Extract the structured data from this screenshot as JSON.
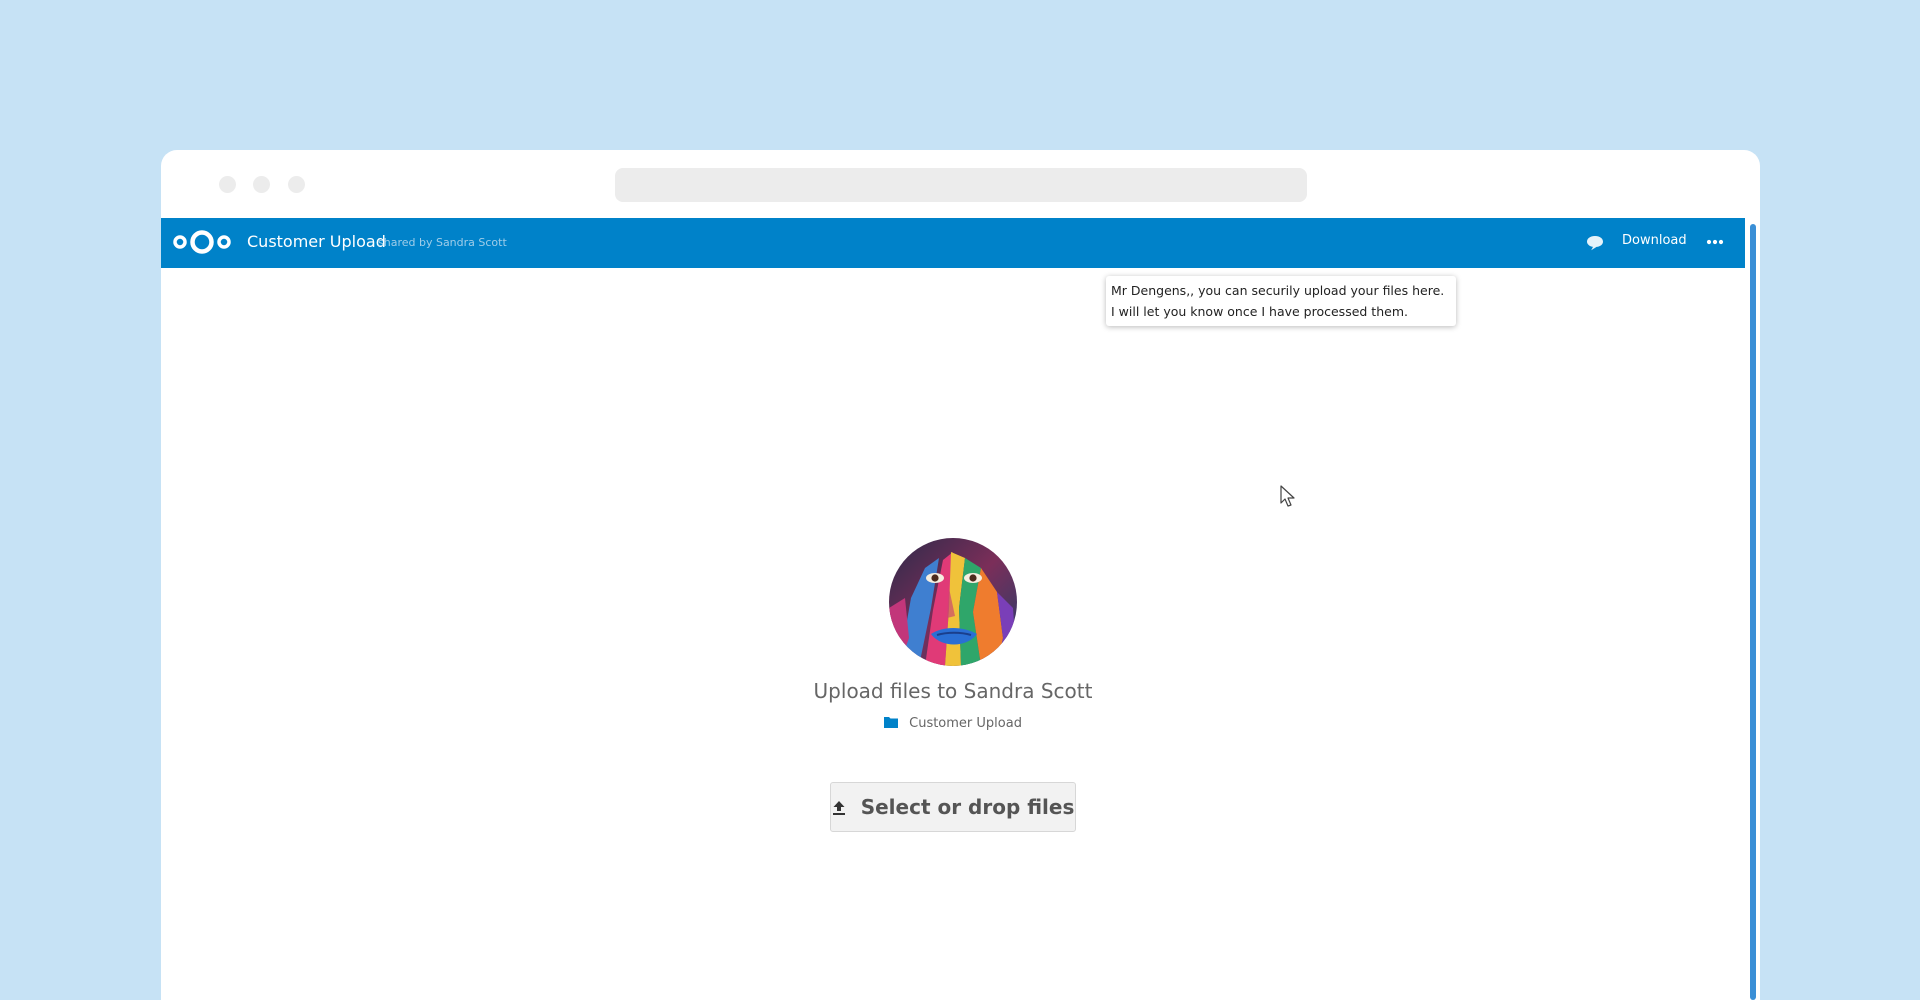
{
  "header": {
    "title": "Customer Upload",
    "subtitle": "shared by Sandra Scott",
    "download_label": "Download",
    "accent_color": "#0082c9"
  },
  "note": {
    "text": "Mr Dengens,, you can securily upload your files here. I will let you know once I have processed them."
  },
  "upload": {
    "heading": "Upload files to Sandra Scott",
    "folder_name": "Customer Upload",
    "button_label": "Select or drop files"
  },
  "icons": {
    "logo": "nextcloud-logo",
    "note": "speech-bubble-icon",
    "more": "more-horizontal-icon",
    "folder": "folder-icon",
    "upload": "upload-icon"
  }
}
